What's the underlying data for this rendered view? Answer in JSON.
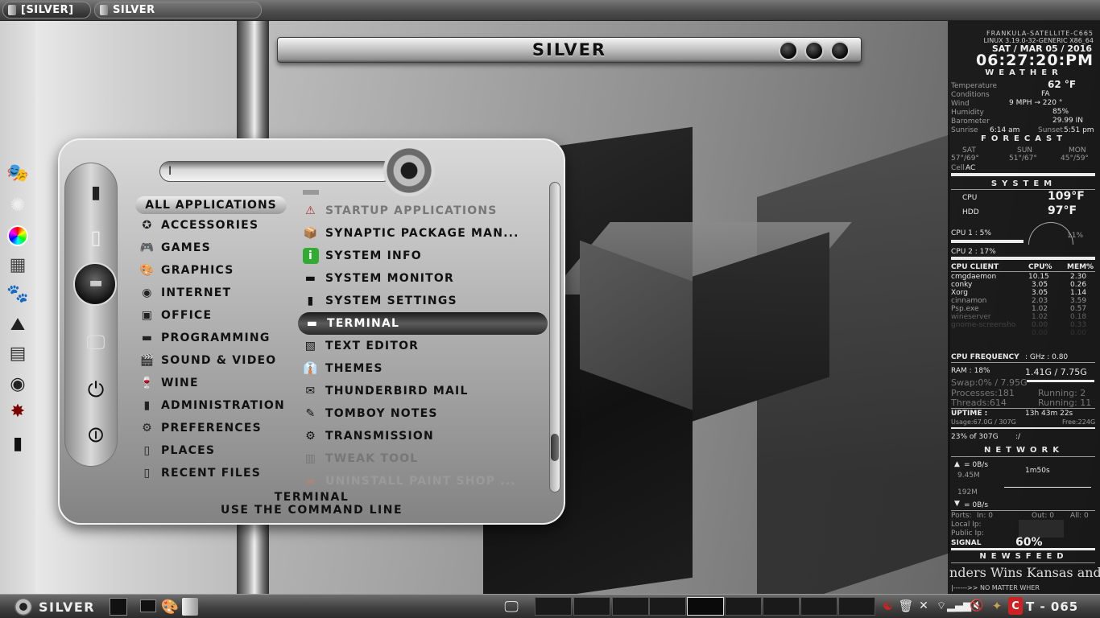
{
  "top_panel": {
    "tasks": [
      {
        "label": "[SILVER]"
      },
      {
        "label": "SILVER"
      }
    ]
  },
  "window": {
    "title": "SILVER"
  },
  "menu": {
    "search_value": "I",
    "category_header": "ALL APPLICATIONS",
    "categories": [
      {
        "label": "ACCESSORIES",
        "icon": "accessories-icon"
      },
      {
        "label": "GAMES",
        "icon": "gamepad-icon"
      },
      {
        "label": "GRAPHICS",
        "icon": "graphics-icon"
      },
      {
        "label": "INTERNET",
        "icon": "globe-icon"
      },
      {
        "label": "OFFICE",
        "icon": "office-icon"
      },
      {
        "label": "PROGRAMMING",
        "icon": "terminal-icon"
      },
      {
        "label": "SOUND & VIDEO",
        "icon": "clapper-icon"
      },
      {
        "label": "WINE",
        "icon": "wine-icon"
      },
      {
        "label": "ADMINISTRATION",
        "icon": "admin-icon"
      },
      {
        "label": "PREFERENCES",
        "icon": "preferences-icon"
      },
      {
        "label": "PLACES",
        "icon": "folder-icon"
      },
      {
        "label": "RECENT FILES",
        "icon": "recent-icon"
      }
    ],
    "apps": [
      {
        "label": "STARTUP APPLICATIONS",
        "icon": "startup-icon",
        "faded": true
      },
      {
        "label": "SYNAPTIC PACKAGE MAN...",
        "icon": "package-icon"
      },
      {
        "label": "SYSTEM INFO",
        "icon": "info-icon"
      },
      {
        "label": "SYSTEM MONITOR",
        "icon": "monitor-icon"
      },
      {
        "label": "SYSTEM SETTINGS",
        "icon": "settings-icon"
      },
      {
        "label": "TERMINAL",
        "icon": "terminal-icon",
        "selected": true
      },
      {
        "label": "TEXT EDITOR",
        "icon": "text-editor-icon"
      },
      {
        "label": "THEMES",
        "icon": "themes-icon"
      },
      {
        "label": "THUNDERBIRD MAIL",
        "icon": "mail-icon"
      },
      {
        "label": "TOMBOY NOTES",
        "icon": "notes-icon"
      },
      {
        "label": "TRANSMISSION",
        "icon": "torrent-icon"
      },
      {
        "label": "TWEAK TOOL",
        "icon": "tweak-icon",
        "faded": true
      },
      {
        "label": "UNINSTALL PAINT SHOP ...",
        "icon": "uninstall-icon",
        "faded": true
      }
    ],
    "description_title": "TERMINAL",
    "description_text": "USE THE COMMAND LINE"
  },
  "conky": {
    "host": "FRANKULA-SATELLITE-C665",
    "kernel": "LINUX 3.19.0-32-GENERIC X86_64",
    "date": "SAT / MAR 05 / 2016",
    "time": "06:27:20:PM",
    "weather_header": "WEATHER",
    "temperature_label": "Temperature",
    "temperature_value": "62 °F",
    "conditions_label": "Conditions",
    "conditions_value": "FA",
    "wind_label": "Wind",
    "wind_value": "9  MPH → 220 °",
    "humidity_label": "Humidity",
    "humidity_value": "85%",
    "barometer_label": "Barometer",
    "barometer_value": "29.99 IN",
    "sunrise_label": "Sunrise",
    "sunrise_value": "6:14 am",
    "sunset_label": "Sunset",
    "sunset_value": "5:51 pm",
    "forecast_header": "FORECAST",
    "forecast": [
      {
        "day": "SAT",
        "temps": "57°/69°"
      },
      {
        "day": "SUN",
        "temps": "51°/67°"
      },
      {
        "day": "MON",
        "temps": "45°/59°"
      }
    ],
    "cell_label": "Cell",
    "cell_value": "AC",
    "system_header": "SYSTEM",
    "cpu_temp_label": "CPU",
    "cpu_temp_value": "109°F",
    "hdd_temp_label": "HDD",
    "hdd_temp_value": "97°F",
    "cpu1_label": "CPU 1 : 5%",
    "cpu1_pct": 5,
    "cpu_gauge_label": "11%",
    "cpu2_label": "CPU 2 : 17%",
    "cpu2_pct": 17,
    "proc_headers": [
      "CPU CLIENT",
      "CPU%",
      "MEM%"
    ],
    "processes": [
      [
        "cmgdaemon",
        "10.15",
        "2.30"
      ],
      [
        "conky",
        "3.05",
        "0.26"
      ],
      [
        "Xorg",
        "3.05",
        "1.14"
      ],
      [
        "cinnamon",
        "2.03",
        "3.59"
      ],
      [
        "Psp.exe",
        "1.02",
        "0.57"
      ],
      [
        "wineserver",
        "1.02",
        "0.18"
      ],
      [
        "gnome-screensho",
        "0.00",
        "0.33"
      ],
      [
        "",
        "0.00",
        "0.00"
      ]
    ],
    "cpu_freq_label": "CPU FREQUENCY",
    "cpu_freq_value": ": GHz : 0.80",
    "ram_label": "RAM : 18%",
    "ram_pct": 18,
    "ram_value": "1.41G / 7.75G",
    "swap_label": "Swap:0% / 7.95G",
    "processes_label": "Processes:181",
    "running_label": "Running: 2",
    "threads_label": "Threads:614",
    "running2_label": "Running: 11",
    "uptime_label": "UPTIME :",
    "uptime_value": "13h 43m 22s",
    "usage_label": "Usage:67.0G / 307G",
    "free_label": "Free:224G",
    "disk_label": "23% of 307G",
    "disk_extra": ":/",
    "network_header": "NETWORK",
    "up_rate": "= 0B/s",
    "up_total": "9.45M",
    "net_timer": "1m50s",
    "down_total": "192M",
    "down_rate": "= 0B/s",
    "ports_label": "Ports:",
    "ports_in": "In: 0",
    "ports_out": "Out: 0",
    "ports_all": "All: 0",
    "local_ip_label": "Local Ip:",
    "public_ip_label": "Public Ip:",
    "signal_label": "SIGNAL",
    "signal_value": "60%",
    "newsfeed_header": "NEWSFEED",
    "news_text": "nders Wins Kansas and",
    "news_footer": "|------>>    NO MATTER WHER"
  },
  "bottom_panel": {
    "menu_label": "SILVER",
    "clock": "T - 065"
  },
  "colors": {
    "menu_bg": "#bcbcbc",
    "selected_bg": "#2a2a2a",
    "conky_bg": "#0a0a0a"
  }
}
